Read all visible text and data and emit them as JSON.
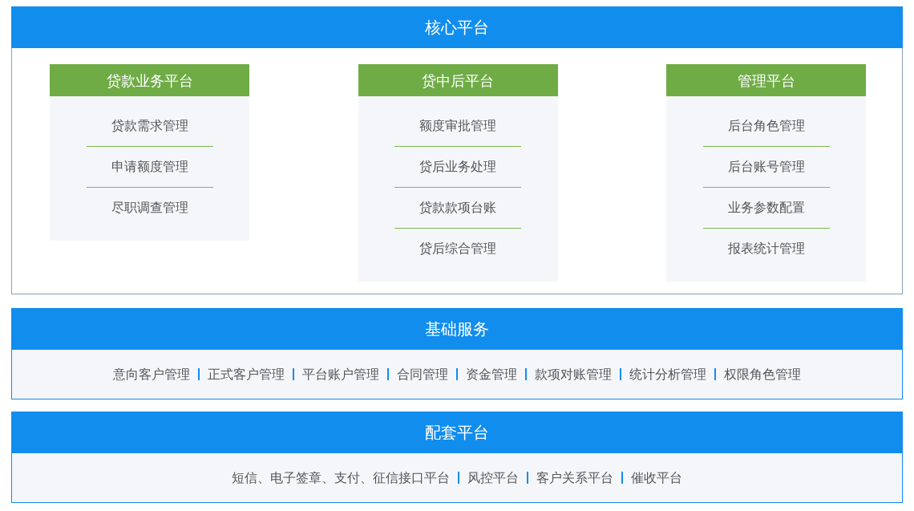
{
  "core_platform": {
    "title": "核心平台",
    "platforms": [
      {
        "title": "贷款业务平台",
        "items": [
          "贷款需求管理",
          "申请额度管理",
          "尽职调查管理"
        ]
      },
      {
        "title": "贷中后平台",
        "items": [
          "额度审批管理",
          "贷后业务处理",
          "贷款款项台账",
          "贷后综合管理"
        ]
      },
      {
        "title": "管理平台",
        "items": [
          "后台角色管理",
          "后台账号管理",
          "业务参数配置",
          "报表统计管理"
        ]
      }
    ]
  },
  "base_services": {
    "title": "基础服务",
    "items": [
      "意向客户管理",
      "正式客户管理",
      "平台账户管理",
      "合同管理",
      "资金管理",
      "款项对账管理",
      "统计分析管理",
      "权限角色管理"
    ]
  },
  "supporting_platform": {
    "title": "配套平台",
    "items": [
      "短信、电子签章、支付、征信接口平台",
      "风控平台",
      "客户关系平台",
      "催收平台"
    ]
  }
}
